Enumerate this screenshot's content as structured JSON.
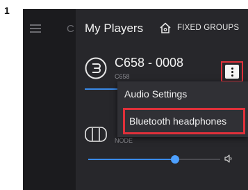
{
  "step_number": "1",
  "background_app": {
    "menu_icon": "hamburger-icon",
    "partial_letter": "C"
  },
  "header": {
    "title": "My Players",
    "fixed_groups_icon": "home-icon",
    "fixed_groups_label": "FIXED GROUPS"
  },
  "player_1": {
    "icon": "speaker-device-icon",
    "name": "C658 - 0008",
    "model": "C658",
    "menu_icon": "more-vertical-icon"
  },
  "dropdown_menu": {
    "items": [
      {
        "label": "Audio Settings"
      },
      {
        "label": "Bluetooth headphones",
        "highlighted": true
      }
    ]
  },
  "player_2": {
    "icon": "node-device-icon",
    "model": "NODE",
    "volume_fraction": 0.66,
    "volume_icon": "speaker-volume-icon"
  },
  "colors": {
    "accent_blue": "#3a8ae8",
    "highlight_red": "#e0303a",
    "panel_bg": "#27272b"
  }
}
